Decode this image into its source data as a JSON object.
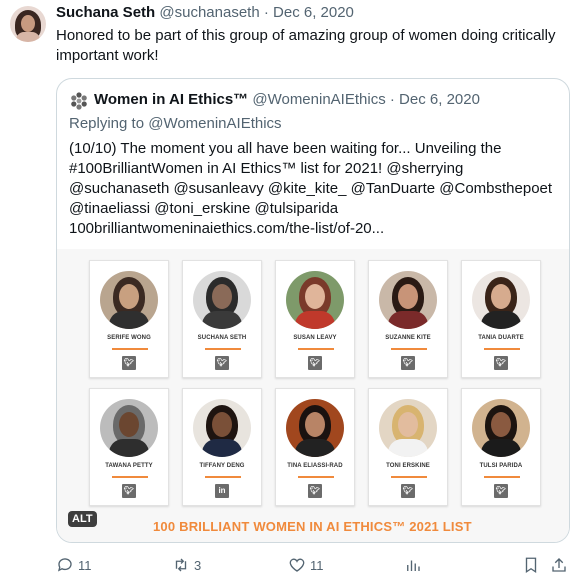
{
  "tweet": {
    "author_name": "Suchana Seth",
    "author_handle": "@suchanaseth",
    "separator": "·",
    "date": "Dec 6, 2020",
    "text": "Honored to be part of this group of amazing group of women doing critically important work!"
  },
  "quoted": {
    "author_name": "Women in AI Ethics™",
    "author_handle": "@WomeninAIEthics",
    "separator": "·",
    "date": "Dec 6, 2020",
    "replying_prefix": "Replying to ",
    "replying_to": "@WomeninAIEthics",
    "text": "(10/10) The moment you all have been waiting for... Unveiling the #100BrilliantWomen in AI Ethics™ list for 2021! @sherrying @suchanaseth @susanleavy @kite_kite_ @TanDuarte @Combsthepoet @tinaeliassi @toni_erskine @tulsiparida 100brilliantwomeninaiethics.com/the-list/of-20..."
  },
  "image": {
    "alt_badge": "ALT",
    "banner": "100 BRILLIANT WOMEN IN AI ETHICS™ 2021 LIST",
    "cards": [
      {
        "name": "SERIFE WONG",
        "social_icon": "twitter-icon",
        "social_glyph": "🐦︎"
      },
      {
        "name": "SUCHANA SETH",
        "social_icon": "twitter-icon",
        "social_glyph": "🐦︎"
      },
      {
        "name": "SUSAN LEAVY",
        "social_icon": "twitter-icon",
        "social_glyph": "🐦︎"
      },
      {
        "name": "SUZANNE KITE",
        "social_icon": "twitter-icon",
        "social_glyph": "🐦︎"
      },
      {
        "name": "TANIA DUARTE",
        "social_icon": "twitter-icon",
        "social_glyph": "🐦︎"
      },
      {
        "name": "TAWANA PETTY",
        "social_icon": "twitter-icon",
        "social_glyph": "🐦︎"
      },
      {
        "name": "TIFFANY DENG",
        "social_icon": "linkedin-icon",
        "social_glyph": "in"
      },
      {
        "name": "TINA ELIASSI-RAD",
        "social_icon": "twitter-icon",
        "social_glyph": "🐦︎"
      },
      {
        "name": "TONI ERSKINE",
        "social_icon": "twitter-icon",
        "social_glyph": "🐦︎"
      },
      {
        "name": "TULSI PARIDA",
        "social_icon": "twitter-icon",
        "social_glyph": "🐦︎"
      }
    ]
  },
  "actions": {
    "reply_count": "11",
    "retweet_count": "3",
    "like_count": "11"
  },
  "colors": {
    "text_primary": "#0f1419",
    "text_secondary": "#536471",
    "border": "#cfd9de",
    "accent_orange": "#f08a3c"
  }
}
